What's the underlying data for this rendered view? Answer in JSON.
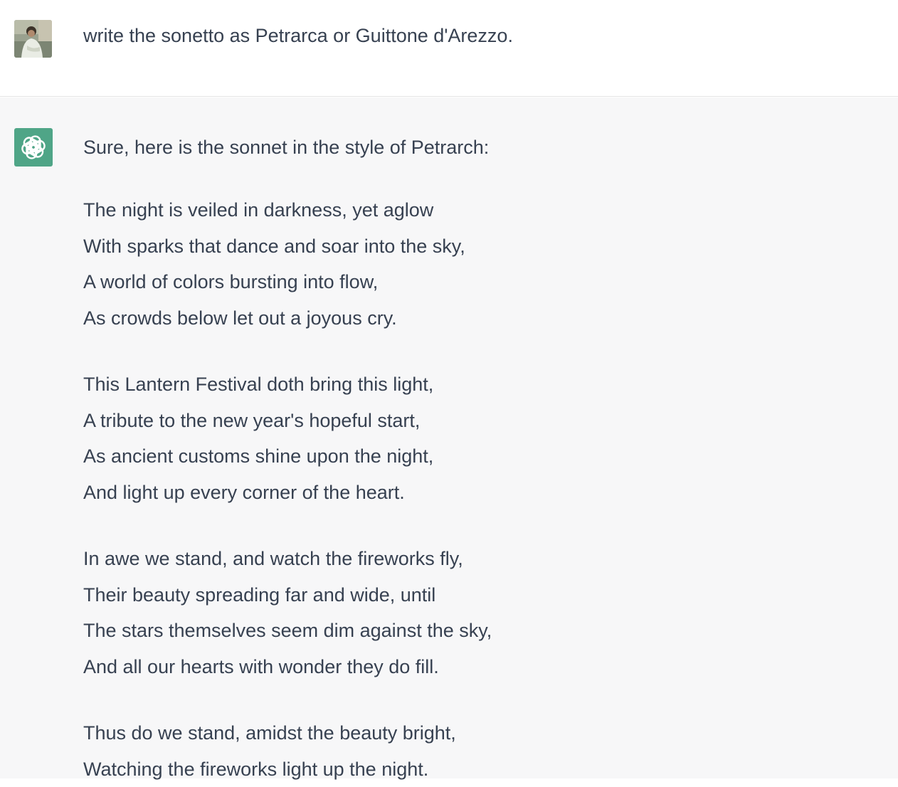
{
  "user": {
    "avatar": "user-photo-avatar",
    "message": "write the sonetto as Petrarca or Guittone d'Arezzo."
  },
  "assistant": {
    "avatar": "openai-logo-icon",
    "avatar_color": "#4fa587",
    "intro": "Sure, here is the sonnet in the style of Petrarch:",
    "stanzas": [
      [
        "The night is veiled in darkness, yet aglow",
        "With sparks that dance and soar into the sky,",
        "A world of colors bursting into flow,",
        "As crowds below let out a joyous cry."
      ],
      [
        "This Lantern Festival doth bring this light,",
        "A tribute to the new year's hopeful start,",
        "As ancient customs shine upon the night,",
        "And light up every corner of the heart."
      ],
      [
        "In awe we stand, and watch the fireworks fly,",
        "Their beauty spreading far and wide, until",
        "The stars themselves seem dim against the sky,",
        "And all our hearts with wonder they do fill."
      ],
      [
        "Thus do we stand, amidst the beauty bright,",
        "Watching the fireworks light up the night."
      ]
    ]
  }
}
